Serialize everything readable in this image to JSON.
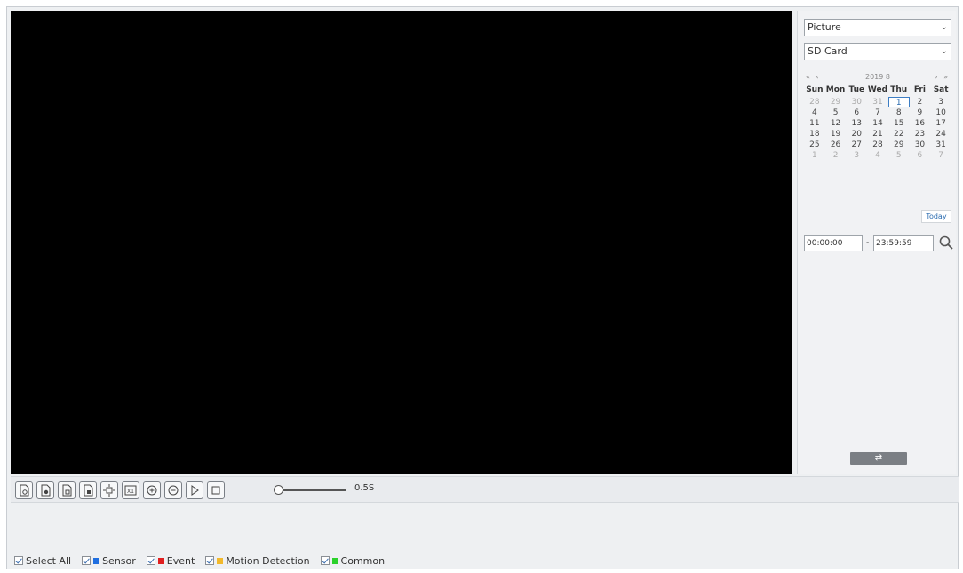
{
  "sidebar": {
    "type_select": "Picture",
    "storage_select": "SD Card",
    "calendar": {
      "prev_nav": "« ‹",
      "title": "2019  8",
      "next_nav": "› »",
      "weekdays": [
        "Sun",
        "Mon",
        "Tue",
        "Wed",
        "Thu",
        "Fri",
        "Sat"
      ],
      "days": [
        {
          "d": "28",
          "other": true
        },
        {
          "d": "29",
          "other": true
        },
        {
          "d": "30",
          "other": true
        },
        {
          "d": "31",
          "other": true
        },
        {
          "d": "1",
          "sel": true
        },
        {
          "d": "2"
        },
        {
          "d": "3"
        },
        {
          "d": "4"
        },
        {
          "d": "5"
        },
        {
          "d": "6"
        },
        {
          "d": "7"
        },
        {
          "d": "8"
        },
        {
          "d": "9"
        },
        {
          "d": "10"
        },
        {
          "d": "11"
        },
        {
          "d": "12"
        },
        {
          "d": "13"
        },
        {
          "d": "14"
        },
        {
          "d": "15"
        },
        {
          "d": "16"
        },
        {
          "d": "17"
        },
        {
          "d": "18"
        },
        {
          "d": "19"
        },
        {
          "d": "20"
        },
        {
          "d": "21"
        },
        {
          "d": "22"
        },
        {
          "d": "23"
        },
        {
          "d": "24"
        },
        {
          "d": "25"
        },
        {
          "d": "26"
        },
        {
          "d": "27"
        },
        {
          "d": "28"
        },
        {
          "d": "29"
        },
        {
          "d": "30"
        },
        {
          "d": "31"
        },
        {
          "d": "1",
          "other": true
        },
        {
          "d": "2",
          "other": true
        },
        {
          "d": "3",
          "other": true
        },
        {
          "d": "4",
          "other": true
        },
        {
          "d": "5",
          "other": true
        },
        {
          "d": "6",
          "other": true
        },
        {
          "d": "7",
          "other": true
        }
      ],
      "today_label": "Today"
    },
    "start_time": "00:00:00",
    "separator": "-",
    "end_time": "23:59:59",
    "switch_label": "⇄"
  },
  "toolbar": {
    "speed": "0.5S"
  },
  "filters": {
    "items": [
      {
        "label": "Select All",
        "color": null
      },
      {
        "label": "Sensor",
        "color": "#1f6fe0"
      },
      {
        "label": "Event",
        "color": "#e01f1f"
      },
      {
        "label": "Motion Detection",
        "color": "#f2b92b"
      },
      {
        "label": "Common",
        "color": "#2bd12b"
      }
    ]
  }
}
